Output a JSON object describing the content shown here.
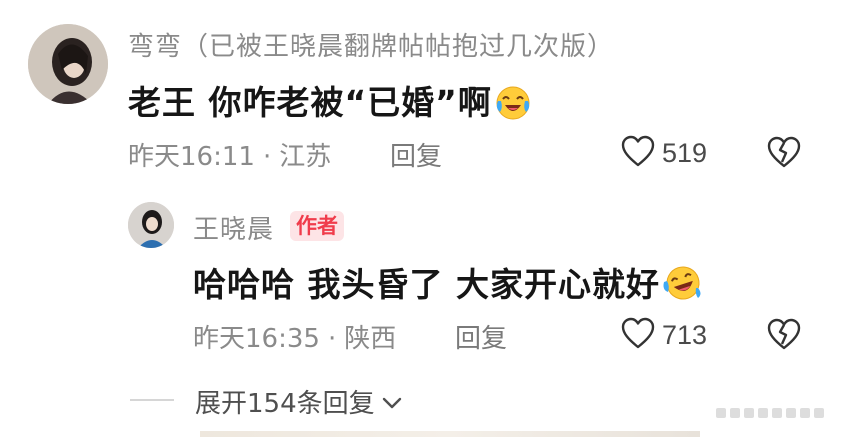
{
  "comments": [
    {
      "username": "弯弯（已被王晓晨翻牌帖帖抱过几次版）",
      "content": "老王 你咋老被“已婚”啊",
      "content_emoji": "crying-laughing-emoji",
      "time": "昨天16:11",
      "location": "江苏",
      "reply_label": "回复",
      "likes": "519"
    }
  ],
  "reply": {
    "username": "王晓晨",
    "badge": "作者",
    "content": "哈哈哈 我头昏了 大家开心就好",
    "content_emoji": "laughing-tears-emoji",
    "time": "昨天16:35",
    "location": "陕西",
    "reply_label": "回复",
    "likes": "713"
  },
  "expand_label": "展开154条回复",
  "icons": {
    "like": "heart-outline-icon",
    "dislike": "broken-heart-icon",
    "expand": "chevron-down-icon"
  },
  "colors": {
    "badge_bg": "#fde4e6",
    "badge_text": "#f03c4b",
    "meta_text": "#8a8a8a",
    "content_text": "#161616"
  }
}
